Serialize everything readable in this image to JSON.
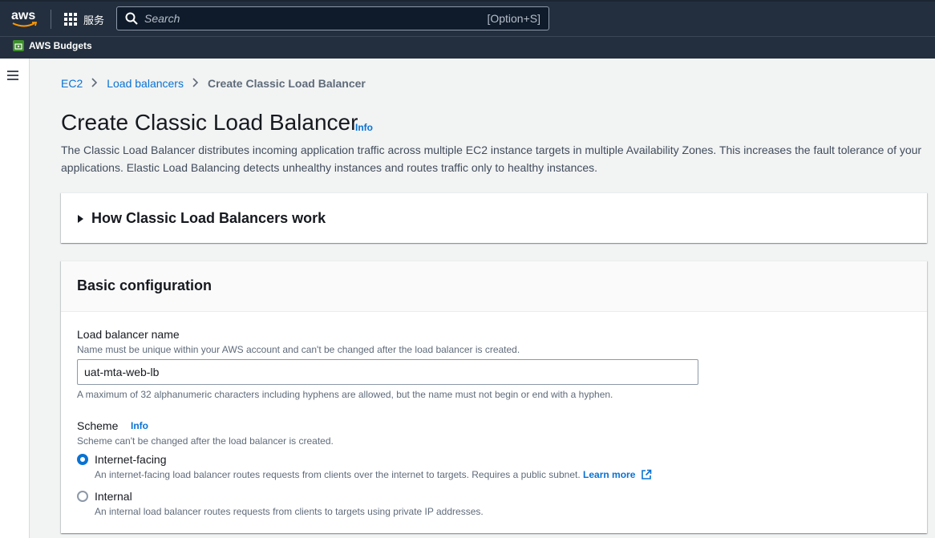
{
  "topnav": {
    "logo_text": "aws",
    "services_label": "服务",
    "search_placeholder": "Search",
    "search_shortcut": "[Option+S]"
  },
  "subnav": {
    "budgets_label": "AWS Budgets"
  },
  "breadcrumb": {
    "items": [
      "EC2",
      "Load balancers"
    ],
    "current": "Create Classic Load Balancer"
  },
  "page": {
    "title": "Create Classic Load Balancer",
    "info": "Info",
    "description": "The Classic Load Balancer distributes incoming application traffic across multiple EC2 instance targets in multiple Availability Zones. This increases the fault tolerance of your applications. Elastic Load Balancing detects unhealthy instances and routes traffic only to healthy instances."
  },
  "how_panel": {
    "label": "How Classic Load Balancers work"
  },
  "basic_config": {
    "heading": "Basic configuration",
    "name_label": "Load balancer name",
    "name_desc": "Name must be unique within your AWS account and can't be changed after the load balancer is created.",
    "name_value": "uat-mta-web-lb",
    "name_constraint": "A maximum of 32 alphanumeric characters including hyphens are allowed, but the name must not begin or end with a hyphen.",
    "scheme_label": "Scheme",
    "scheme_info": "Info",
    "scheme_desc": "Scheme can't be changed after the load balancer is created.",
    "options": [
      {
        "label": "Internet-facing",
        "desc": "An internet-facing load balancer routes requests from clients over the internet to targets. Requires a public subnet.",
        "link": "Learn more",
        "checked": true
      },
      {
        "label": "Internal",
        "desc": "An internal load balancer routes requests from clients to targets using private IP addresses.",
        "checked": false
      }
    ]
  },
  "colors": {
    "nav_bg": "#232f3e",
    "link": "#0972d3",
    "page_bg": "#f2f3f3"
  }
}
